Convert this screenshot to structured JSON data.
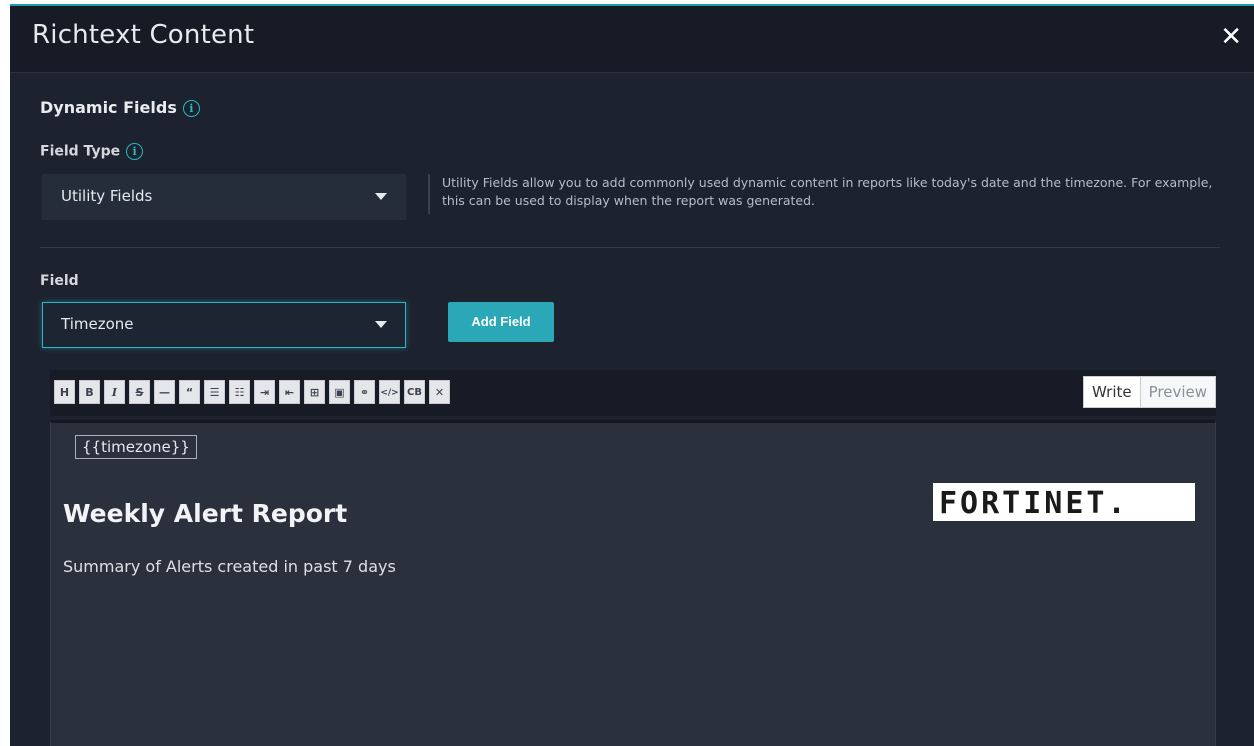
{
  "modal": {
    "title": "Richtext Content",
    "close_glyph": "✕"
  },
  "dynamic_fields": {
    "title": "Dynamic Fields",
    "info_glyph": "i",
    "field_type_label": "Field Type",
    "field_type_value": "Utility Fields",
    "help_text": "Utility Fields allow you to add commonly used dynamic content in reports like today's date and the timezone. For example, this can be used to display when the report was generated.",
    "field_label": "Field",
    "field_value": "Timezone",
    "add_button_label": "Add Field"
  },
  "toolbar": {
    "buttons": [
      {
        "glyph": "H",
        "icon": "heading-icon"
      },
      {
        "glyph": "B",
        "icon": "bold-icon"
      },
      {
        "glyph": "I",
        "icon": "italic-icon"
      },
      {
        "glyph": "S",
        "icon": "strikethrough-icon"
      },
      {
        "glyph": "—",
        "icon": "horizontal-rule-icon"
      },
      {
        "glyph": "“",
        "icon": "quote-icon"
      },
      {
        "glyph": "☰",
        "icon": "bullet-list-icon"
      },
      {
        "glyph": "☷",
        "icon": "numbered-list-icon"
      },
      {
        "glyph": "⇥",
        "icon": "indent-icon"
      },
      {
        "glyph": "⇤",
        "icon": "outdent-icon"
      },
      {
        "glyph": "⊞",
        "icon": "table-icon"
      },
      {
        "glyph": "▣",
        "icon": "image-icon"
      },
      {
        "glyph": "⚭",
        "icon": "link-icon"
      },
      {
        "glyph": "</>",
        "icon": "code-icon"
      },
      {
        "glyph": "CB",
        "icon": "code-block-icon"
      },
      {
        "glyph": "✕",
        "icon": "fullscreen-icon"
      }
    ],
    "write_label": "Write",
    "preview_label": "Preview"
  },
  "editor": {
    "chip_text": "{{timezone}}",
    "report_title": "Weekly Alert Report",
    "report_subtitle": "Summary of Alerts created in past 7 days",
    "logo_text": "FORTINET."
  },
  "colors": {
    "accent": "#2aa8b8",
    "modal_bg": "#1c222e",
    "editor_bg": "#2a303c"
  }
}
